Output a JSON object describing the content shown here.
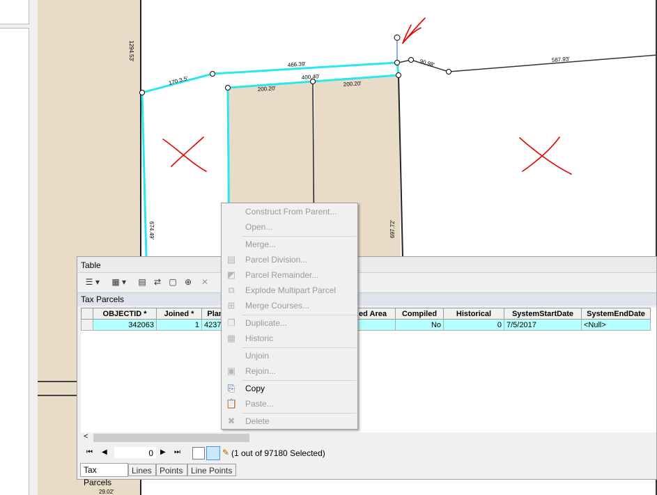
{
  "map": {
    "dimension_labels": [
      "1294.53'",
      "170.3.5'",
      "466.39'",
      "400.40'",
      "200.20'",
      "200.20'",
      "90.98'",
      "587.93'",
      "674.49'",
      "697.72'",
      "29.02'"
    ],
    "colors": {
      "parcel_fill": "#e8dcc8",
      "highlight": "#29e6f0",
      "annotation": "#e60000",
      "line": "#222222"
    }
  },
  "table_window": {
    "title": "Table",
    "layer_name": "Tax Parcels",
    "columns": [
      "OBJECTID *",
      "Joined *",
      "Plan",
      "",
      "",
      "ed Area",
      "Compiled",
      "Historical",
      "SystemStartDate",
      "SystemEndDate"
    ],
    "rows": [
      [
        "342063",
        "1",
        "4237",
        "",
        "",
        "a",
        "No",
        "0",
        "7/5/2017",
        "<Null>"
      ]
    ],
    "record_number": "0",
    "selection_status": "(1 out of 97180 Selected)",
    "tabs": [
      "Tax Parcels",
      "Lines",
      "Points",
      "Line Points"
    ]
  },
  "context_menu": {
    "items": [
      {
        "label": "Construct From Parent...",
        "enabled": false,
        "icon": ""
      },
      {
        "label": "Open...",
        "enabled": false,
        "icon": ""
      },
      {
        "label": "Merge...",
        "enabled": false,
        "icon": ""
      },
      {
        "label": "Parcel Division...",
        "enabled": false,
        "icon": "parcel-division-icon"
      },
      {
        "label": "Parcel Remainder...",
        "enabled": false,
        "icon": "parcel-remainder-icon"
      },
      {
        "label": "Explode Multipart Parcel",
        "enabled": false,
        "icon": "explode-icon"
      },
      {
        "label": "Merge Courses...",
        "enabled": false,
        "icon": "merge-courses-icon"
      },
      {
        "label": "Duplicate...",
        "enabled": false,
        "icon": "duplicate-icon"
      },
      {
        "label": "Historic",
        "enabled": false,
        "icon": "historic-icon"
      },
      {
        "label": "Unjoin",
        "enabled": false,
        "icon": ""
      },
      {
        "label": "Rejoin...",
        "enabled": false,
        "icon": "rejoin-icon"
      },
      {
        "label": "Copy",
        "enabled": true,
        "icon": "copy-icon"
      },
      {
        "label": "Paste...",
        "enabled": false,
        "icon": "paste-icon"
      },
      {
        "label": "Delete",
        "enabled": false,
        "icon": "delete-icon"
      }
    ]
  }
}
